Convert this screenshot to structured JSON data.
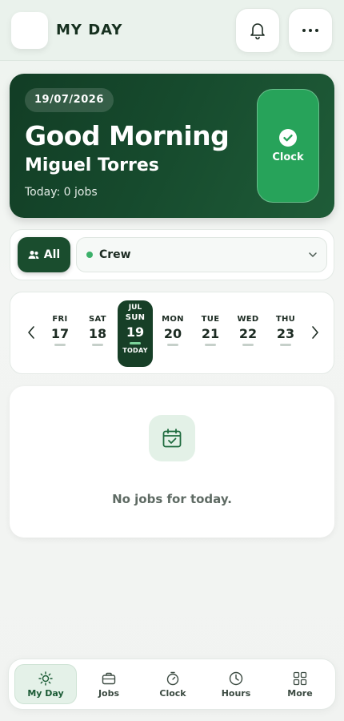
{
  "header": {
    "title": "MY DAY",
    "bell_icon": "bell-icon",
    "more_icon": "more-icon"
  },
  "hero": {
    "date": "19/07/2026",
    "greeting": "Good Morning",
    "user_name": "Miguel Torres",
    "jobs_summary": "Today: 0 jobs",
    "clock_label": "Clock",
    "clock_icon": "check-circle-icon"
  },
  "filters": {
    "all_label": "All",
    "crew_selected": "Crew"
  },
  "week": {
    "days": [
      {
        "dow": "FRI",
        "num": "17"
      },
      {
        "dow": "SAT",
        "num": "18"
      },
      {
        "month": "JUL",
        "dow": "SUN",
        "num": "19",
        "today": "TODAY"
      },
      {
        "dow": "MON",
        "num": "20"
      },
      {
        "dow": "TUE",
        "num": "21"
      },
      {
        "dow": "WED",
        "num": "22"
      },
      {
        "dow": "THU",
        "num": "23"
      }
    ]
  },
  "empty": {
    "message": "No jobs for today."
  },
  "nav": {
    "items": [
      {
        "label": "My Day",
        "icon": "sun-icon"
      },
      {
        "label": "Jobs",
        "icon": "briefcase-icon"
      },
      {
        "label": "Clock",
        "icon": "stopwatch-icon"
      },
      {
        "label": "Hours",
        "icon": "clock-icon"
      },
      {
        "label": "More",
        "icon": "grid-icon"
      }
    ]
  },
  "colors": {
    "brand_dark": "#173f27",
    "accent_green": "#27a35a",
    "background": "#f1f3f1"
  }
}
